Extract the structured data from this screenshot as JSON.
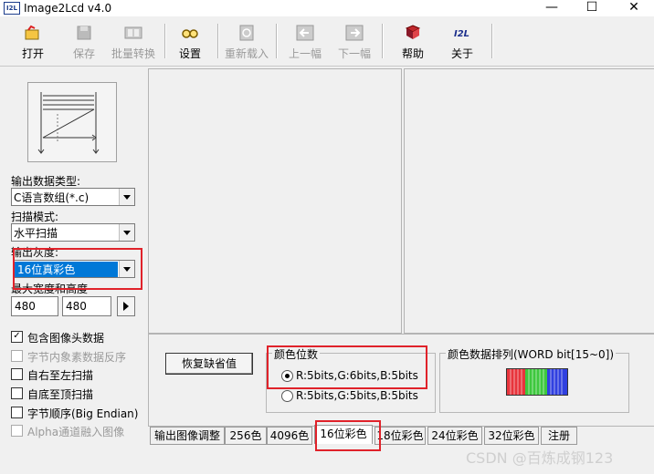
{
  "window": {
    "title": "Image2Lcd v4.0",
    "icon_text": "I2L"
  },
  "toolbar": {
    "open": "打开",
    "save": "保存",
    "batch": "批量转换",
    "settings": "设置",
    "reload": "重新载入",
    "prev": "上一幅",
    "next": "下一幅",
    "help": "帮助",
    "about": "关于"
  },
  "left": {
    "output_type_label": "输出数据类型:",
    "output_type_value": "C语言数组(*.c)",
    "scan_mode_label": "扫描模式:",
    "scan_mode_value": "水平扫描",
    "gray_label": "输出灰度:",
    "gray_value": "16位真彩色",
    "size_label": "最大宽度和高度",
    "max_width": "480",
    "max_height": "480",
    "checks": [
      {
        "label": "包含图像头数据",
        "checked": true,
        "enabled": true
      },
      {
        "label": "字节内象素数据反序",
        "checked": false,
        "enabled": false
      },
      {
        "label": "自右至左扫描",
        "checked": false,
        "enabled": true
      },
      {
        "label": "自底至顶扫描",
        "checked": false,
        "enabled": true
      },
      {
        "label": "字节顺序(Big Endian)",
        "checked": false,
        "enabled": true
      },
      {
        "label": "Alpha通道融入图像",
        "checked": false,
        "enabled": false
      }
    ]
  },
  "bottom": {
    "restore_button": "恢复缺省值",
    "color_bits_title": "颜色位数",
    "radio_1": "R:5bits,G:6bits,B:5bits",
    "radio_2": "R:5bits,G:5bits,B:5bits",
    "order_title": "颜色数据排列(WORD bit[15~0])"
  },
  "tabs": [
    "输出图像调整",
    "256色",
    "4096色",
    "16位彩色",
    "18位彩色",
    "24位彩色",
    "32位彩色",
    "注册"
  ],
  "watermark": "CSDN @百炼成钢123",
  "colors": {
    "highlight": "#e0222a",
    "selection": "#0078d7"
  }
}
